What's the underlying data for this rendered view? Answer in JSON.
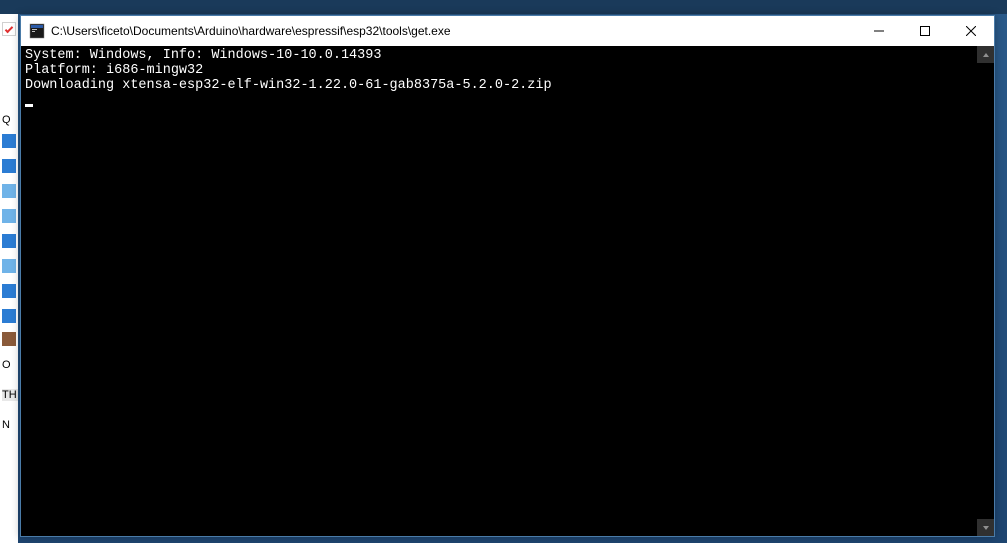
{
  "window": {
    "title": "C:\\Users\\ficeto\\Documents\\Arduino\\hardware\\espressif\\esp32\\tools\\get.exe"
  },
  "console": {
    "line1": "System: Windows, Info: Windows-10-10.0.14393",
    "line2": "Platform: i686-mingw32",
    "line3": "Downloading xtensa-esp32-elf-win32-1.22.0-61-gab8375a-5.2.0-2.zip"
  },
  "bg": {
    "q": "Q",
    "o": "O",
    "th": "TH",
    "n": "N"
  }
}
